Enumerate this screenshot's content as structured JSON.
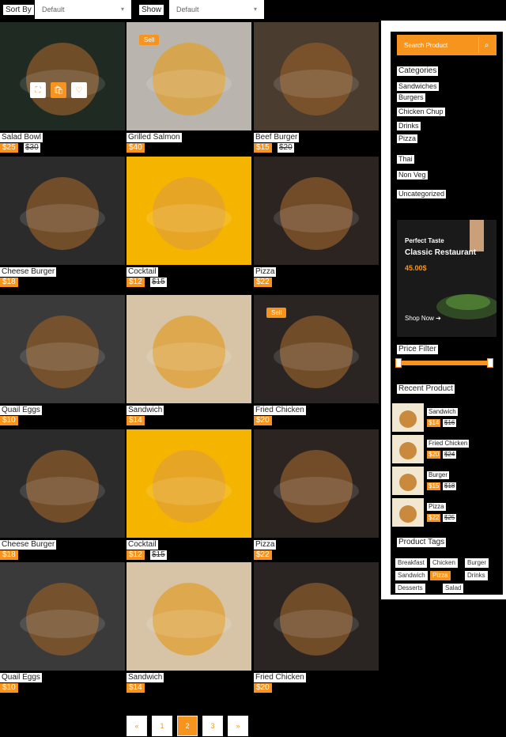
{
  "toolbar": {
    "sort_label": "Sort By",
    "sort_value": "Default",
    "show_label": "Show",
    "show_value": "Default"
  },
  "products": [
    {
      "name": "Salad Bowl",
      "price": "$25",
      "old": "$30",
      "sale": "",
      "bg": "#1e2a22"
    },
    {
      "name": "Grilled Salmon",
      "price": "$40",
      "old": "",
      "sale": "Sell",
      "bg": "#b9b5ae"
    },
    {
      "name": "Beef Burger",
      "price": "$15",
      "old": "$20",
      "sale": "",
      "bg": "#4a3d30"
    },
    {
      "name": "Cheese Burger",
      "price": "$18",
      "old": "",
      "sale": "",
      "bg": "#2b2b2b"
    },
    {
      "name": "Cocktail",
      "price": "$12",
      "old": "$15",
      "sale": "",
      "bg": "#f5b400"
    },
    {
      "name": "Pizza",
      "price": "$22",
      "old": "",
      "sale": "",
      "bg": "#2c2421"
    },
    {
      "name": "Quail Eggs",
      "price": "$10",
      "old": "",
      "sale": "",
      "bg": "#3a3a3a"
    },
    {
      "name": "Sandwich",
      "price": "$14",
      "old": "",
      "sale": "",
      "bg": "#d7c4a6"
    },
    {
      "name": "Fried Chicken",
      "price": "$20",
      "old": "",
      "sale": "Sell",
      "bg": "#2a2522"
    },
    {
      "name": "Cheese Burger",
      "price": "$18",
      "old": "",
      "sale": "",
      "bg": "#2b2b2b"
    },
    {
      "name": "Cocktail",
      "price": "$12",
      "old": "$15",
      "sale": "",
      "bg": "#f5b400"
    },
    {
      "name": "Pizza",
      "price": "$22",
      "old": "",
      "sale": "",
      "bg": "#2c2421"
    },
    {
      "name": "Quail Eggs",
      "price": "$10",
      "old": "",
      "sale": "",
      "bg": "#3a3a3a"
    },
    {
      "name": "Sandwich",
      "price": "$14",
      "old": "",
      "sale": "",
      "bg": "#d7c4a6"
    },
    {
      "name": "Fried Chicken",
      "price": "$20",
      "old": "",
      "sale": "",
      "bg": "#2a2522"
    }
  ],
  "pagination": [
    "«",
    "1",
    "2",
    "3",
    "»"
  ],
  "pagination_active": "2",
  "sidebar": {
    "search_placeholder": "Search Product",
    "categories_title": "Categories",
    "categories": [
      "Sandwiches",
      "Burgers",
      "Chicken Chup",
      "Drinks",
      "Pizza",
      "Thai",
      "Non Veg",
      "Uncategorized"
    ],
    "banner": {
      "tag": "Perfect Taste",
      "title": "Classic Restaurant",
      "price": "45.00$",
      "shop": "Shop Now"
    },
    "price_filter_title": "Price Filter",
    "recent_title": "Recent Product",
    "recent": [
      {
        "name": "Sandwich",
        "price": "$14",
        "old": "$16"
      },
      {
        "name": "Fried Chicken",
        "price": "$20",
        "old": "$24"
      },
      {
        "name": "Burger",
        "price": "$15",
        "old": "$18"
      },
      {
        "name": "Pizza",
        "price": "$22",
        "old": "$25"
      }
    ],
    "tags_title": "Product Tags",
    "tags": [
      "Breakfast",
      "Chicken",
      "Burger",
      "Sandwich",
      "Pizza",
      "Drinks",
      "Desserts",
      "Salad"
    ]
  },
  "colors": {
    "accent": "#f7941d",
    "bg": "#000000"
  }
}
